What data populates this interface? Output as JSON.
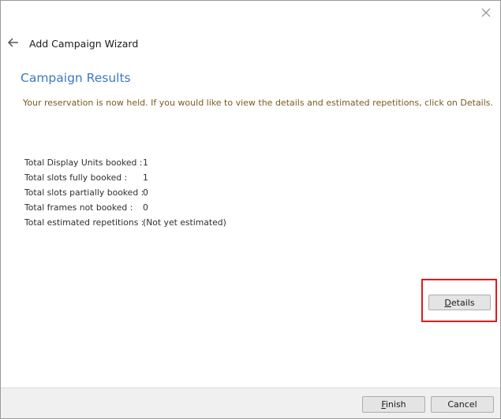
{
  "window": {
    "title": "Add Campaign Wizard"
  },
  "header": {
    "back_icon": "arrow-left-icon",
    "close_icon": "close-icon"
  },
  "section": {
    "title": "Campaign Results",
    "instructions": "Your reservation is now held.  If you would like to view the details and estimated repetitions, click on Details."
  },
  "results": [
    {
      "label": "Total Display Units booked :",
      "value": "1"
    },
    {
      "label": "Total slots fully booked :",
      "value": "1"
    },
    {
      "label": "Total slots partially booked :",
      "value": "0"
    },
    {
      "label": "Total frames not booked :",
      "value": "0"
    },
    {
      "label": "Total estimated repetitions :",
      "value": "(Not yet estimated)"
    }
  ],
  "buttons": {
    "details": {
      "mnemonic": "D",
      "rest": "etails"
    },
    "finish": {
      "mnemonic": "F",
      "rest": "inish"
    },
    "cancel": "Cancel"
  },
  "colors": {
    "section_title": "#3b78c4",
    "instructions": "#7a5a1e",
    "highlight": "#e01a1a",
    "footer_bg": "#f0f0f0"
  }
}
